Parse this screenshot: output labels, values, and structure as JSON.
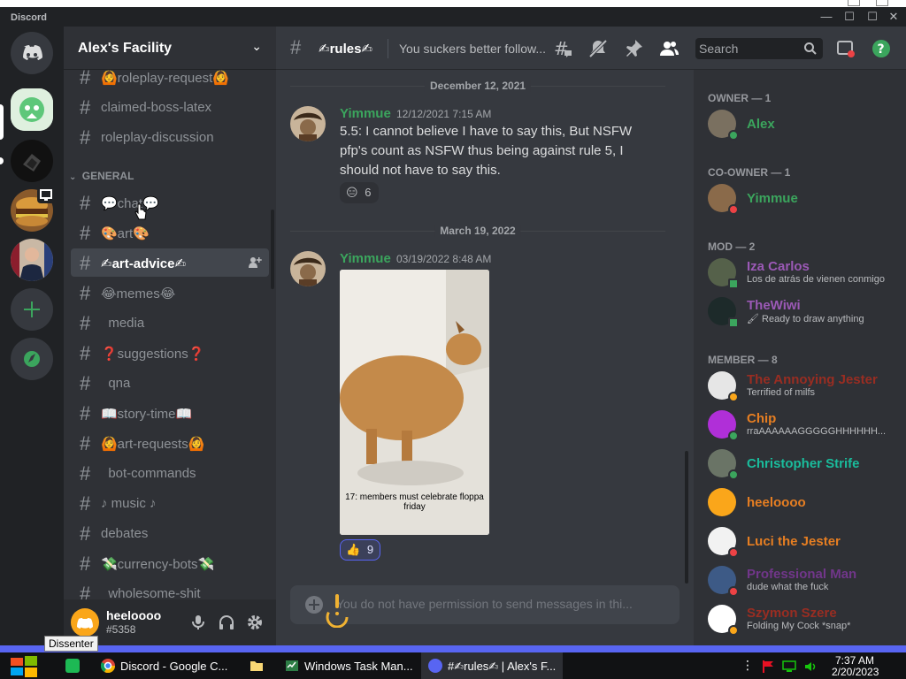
{
  "window": {
    "brand": "Discord",
    "minimize": "—",
    "maximize": "☐",
    "close": "✕"
  },
  "server": {
    "name": "Alex's Facility",
    "chevron": "⌄"
  },
  "channels": [
    {
      "name": "🙆roleplay-request🙆"
    },
    {
      "name": "claimed-boss-latex"
    },
    {
      "name": "roleplay-discussion"
    }
  ],
  "category": {
    "label": "GENERAL",
    "chevron": "⌄"
  },
  "general_channels": [
    {
      "name": "💬chat💬"
    },
    {
      "name": "🎨art🎨"
    },
    {
      "name": "✍art-advice✍",
      "active": true
    },
    {
      "name": "😂memes😂"
    },
    {
      "name": "  media"
    },
    {
      "name": "❓suggestions❓"
    },
    {
      "name": "  qna"
    },
    {
      "name": "📖story-time📖"
    },
    {
      "name": "🙆art-requests🙆"
    },
    {
      "name": "  bot-commands"
    },
    {
      "name": "♪ music ♪"
    },
    {
      "name": "debates"
    },
    {
      "name": "💸currency-bots💸"
    },
    {
      "name": "  wholesome-shit"
    }
  ],
  "user": {
    "name": "heeloooo",
    "tag": "#5358"
  },
  "tooltip": "Dissenter",
  "header": {
    "channel": "✍rules✍",
    "topic": "You suckers better follow...",
    "search_placeholder": "Search"
  },
  "messages": [
    {
      "date": "December 12, 2021",
      "author": "Yimmue",
      "time": "12/12/2021 7:15 AM",
      "text": "5.5: I cannot believe I have to say this, But NSFW pfp's count as NSFW thus being against rule 5, I should not have to say this.",
      "reaction_emoji": "😑",
      "reaction_count": "6"
    },
    {
      "date": "March 19, 2022",
      "author": "Yimmue",
      "time": "03/19/2022 8:48 AM",
      "image_caption": "17: members must celebrate floppa friday",
      "reaction_emoji": "👍",
      "reaction_count": "9"
    }
  ],
  "composer": {
    "placeholder": "You do not have permission to send messages in thi..."
  },
  "member_groups": {
    "owner": "OWNER — 1",
    "coowner": "CO-OWNER — 1",
    "mod": "MOD — 2",
    "member": "MEMBER — 8"
  },
  "members": {
    "alex": {
      "name": "Alex",
      "color": "#3ba55d"
    },
    "yimmue": {
      "name": "Yimmue",
      "color": "#3ba55d"
    },
    "iza": {
      "name": "Iza Carlos",
      "status": "Los de atrás de vienen conmigo",
      "color": "#9b59b6"
    },
    "thewiwi": {
      "name": "TheWiwi",
      "status": "🖌 Ready to draw anything",
      "color": "#9b59b6"
    },
    "hidden": {
      "name": "The Annoying Jester",
      "status": "Terrified of milfs",
      "color": "#992d22"
    },
    "chip": {
      "name": "Chip",
      "status": "rraAAAAAAGGGGGHHHHHH...",
      "color": "#e67e22"
    },
    "christopher": {
      "name": "Christopher Strife",
      "color": "#1abc9c"
    },
    "heeloooo": {
      "name": "heeloooo",
      "color": "#e67e22"
    },
    "luci": {
      "name": "Luci the Jester",
      "color": "#e67e22"
    },
    "professional": {
      "name": "Professional Man",
      "status": "dude what the fuck",
      "color": "#71368a"
    },
    "szymon": {
      "name": "Szymon Szere",
      "status": "Folding My Cock *snap*",
      "color": "#992d22"
    }
  },
  "taskbar": {
    "items": [
      "Discord - Google C...",
      "Windows Task Man...",
      "#✍rules✍ | Alex's F..."
    ],
    "time": "7:37 AM",
    "date": "2/20/2023"
  },
  "icons": [
    "discord-logo-icon",
    "plus-icon",
    "compass-icon",
    "hash-icon",
    "thread-icon",
    "mute-icon",
    "pin-icon",
    "members-icon",
    "search-icon",
    "inbox-icon",
    "help-icon",
    "mic-icon",
    "headphones-icon",
    "gear-icon"
  ]
}
